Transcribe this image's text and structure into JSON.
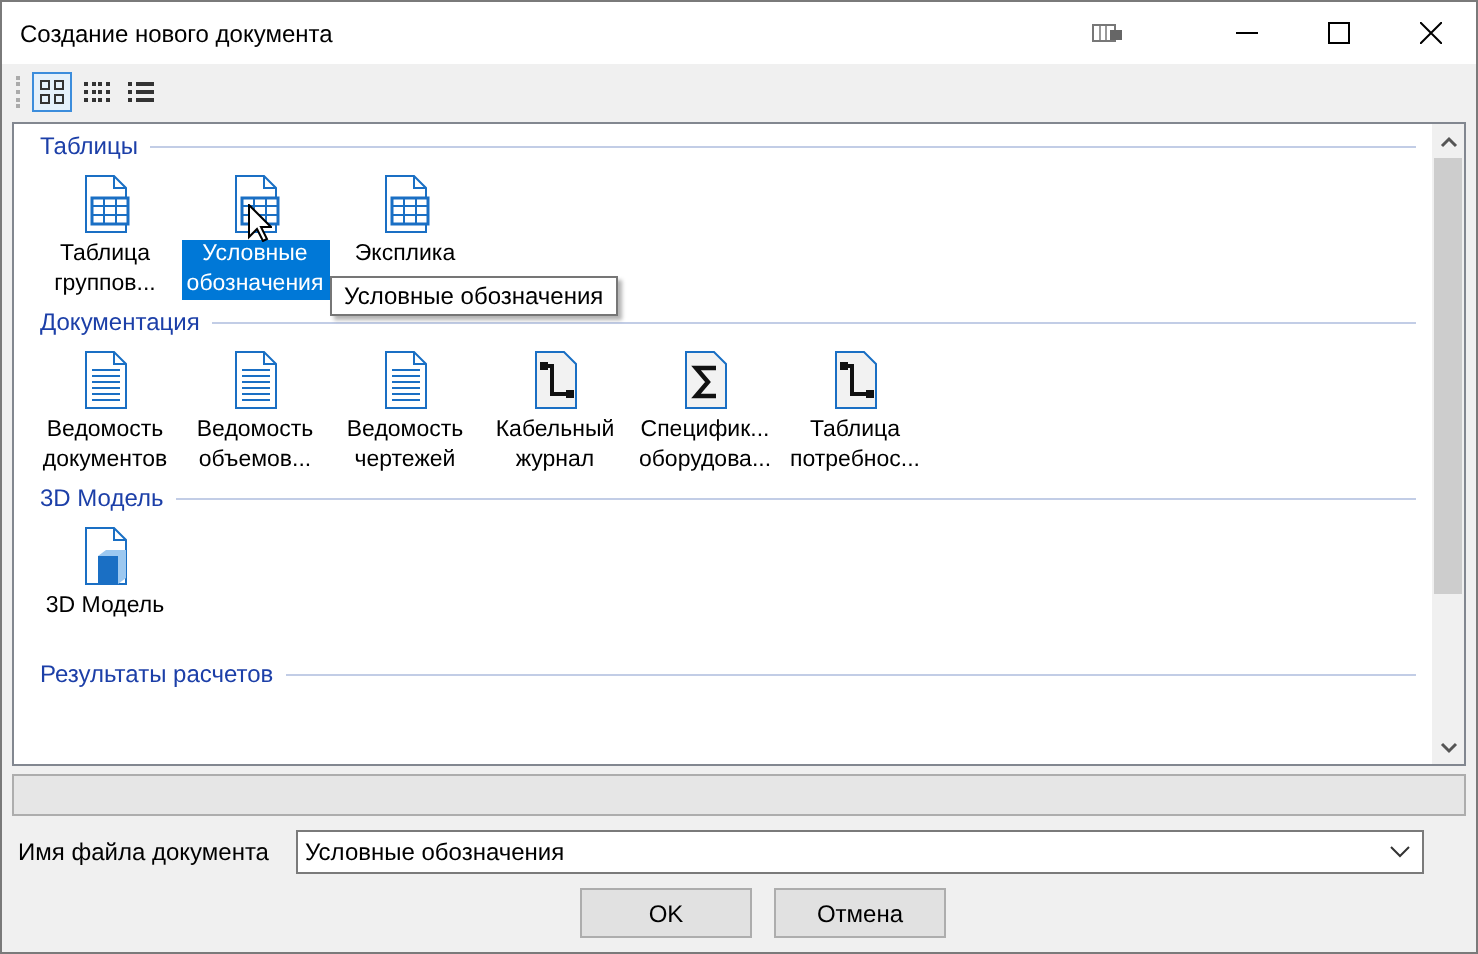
{
  "window": {
    "title": "Создание нового документа"
  },
  "view_modes": [
    {
      "selected": true
    },
    {
      "selected": false
    },
    {
      "selected": false
    }
  ],
  "groups": [
    {
      "title": "Таблицы",
      "items": [
        {
          "label": "Таблица группов...",
          "kind": "table",
          "selected": false
        },
        {
          "label": "Условные обозначения",
          "kind": "table",
          "selected": true
        },
        {
          "label": "Эксплика",
          "kind": "table",
          "selected": false
        }
      ]
    },
    {
      "title": "Документация",
      "items": [
        {
          "label": "Ведомость документов",
          "kind": "doc",
          "selected": false
        },
        {
          "label": "Ведомость объемов...",
          "kind": "doc",
          "selected": false
        },
        {
          "label": "Ведомость чертежей",
          "kind": "doc",
          "selected": false
        },
        {
          "label": "Кабельный журнал",
          "kind": "cable",
          "selected": false
        },
        {
          "label": "Специфик... оборудова...",
          "kind": "sigma",
          "selected": false
        },
        {
          "label": "Таблица потребнос...",
          "kind": "cable",
          "selected": false
        }
      ]
    },
    {
      "title": "3D Модель",
      "items": [
        {
          "label": "3D Модель",
          "kind": "model",
          "selected": false
        }
      ]
    },
    {
      "title": "Результаты расчетов"
    }
  ],
  "tooltip": "Условные обозначения",
  "file_name": {
    "label": "Имя файла документа",
    "value": "Условные обозначения"
  },
  "buttons": [
    "OK",
    "Отмена"
  ]
}
